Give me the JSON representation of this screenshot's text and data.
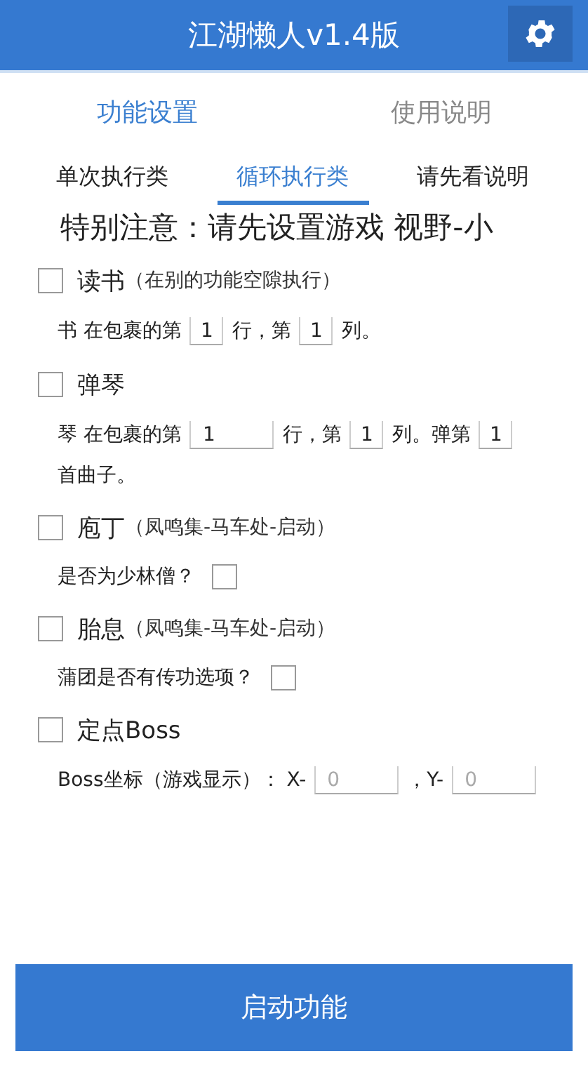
{
  "header": {
    "title": "江湖懒人v1.4版"
  },
  "main_tabs": [
    {
      "label": "功能设置",
      "selected": true
    },
    {
      "label": "使用说明",
      "selected": false
    }
  ],
  "sub_tabs": [
    {
      "label": "单次执行类",
      "selected": false
    },
    {
      "label": "循环执行类",
      "selected": true
    },
    {
      "label": "请先看说明",
      "selected": false
    }
  ],
  "notice": "特别注意：请先设置游戏  视野-小",
  "options": [
    {
      "title": "读书",
      "hint": "（在别的功能空隙执行）",
      "checked": false,
      "detail": [
        {
          "kind": "text",
          "text": "书 在包裹的第"
        },
        {
          "kind": "field",
          "value": "1"
        },
        {
          "kind": "text",
          "text": "行，第"
        },
        {
          "kind": "field",
          "value": "1"
        },
        {
          "kind": "text",
          "text": "列。"
        }
      ]
    },
    {
      "title": "弹琴",
      "checked": false,
      "detail": [
        {
          "kind": "text",
          "text": "琴 在包裹的第"
        },
        {
          "kind": "long-field",
          "value": "1"
        },
        {
          "kind": "text",
          "text": "行，第"
        },
        {
          "kind": "field",
          "value": "1"
        },
        {
          "kind": "text",
          "text": "列。弹第"
        },
        {
          "kind": "field",
          "value": "1"
        },
        {
          "kind": "text",
          "text": "首曲子。"
        }
      ]
    },
    {
      "title": "庖丁",
      "hint": "（凤鸣集-马车处-启动）",
      "checked": false,
      "detail": [
        {
          "kind": "text",
          "text": "是否为少林僧？"
        },
        {
          "kind": "checkbox",
          "checked": false
        }
      ]
    },
    {
      "title": "胎息",
      "hint": "（凤鸣集-马车处-启动）",
      "checked": false,
      "detail": [
        {
          "kind": "text",
          "text": "蒲团是否有传功选项？"
        },
        {
          "kind": "checkbox",
          "checked": false
        }
      ]
    },
    {
      "title": "定点Boss",
      "checked": false,
      "detail": [
        {
          "kind": "text",
          "text": "Boss坐标（游戏显示）：  X-"
        },
        {
          "kind": "long-field",
          "placeholder": "0"
        },
        {
          "kind": "text",
          "text": "，Y-"
        },
        {
          "kind": "long-field",
          "placeholder": "0"
        }
      ]
    }
  ],
  "start_button": "启动功能"
}
